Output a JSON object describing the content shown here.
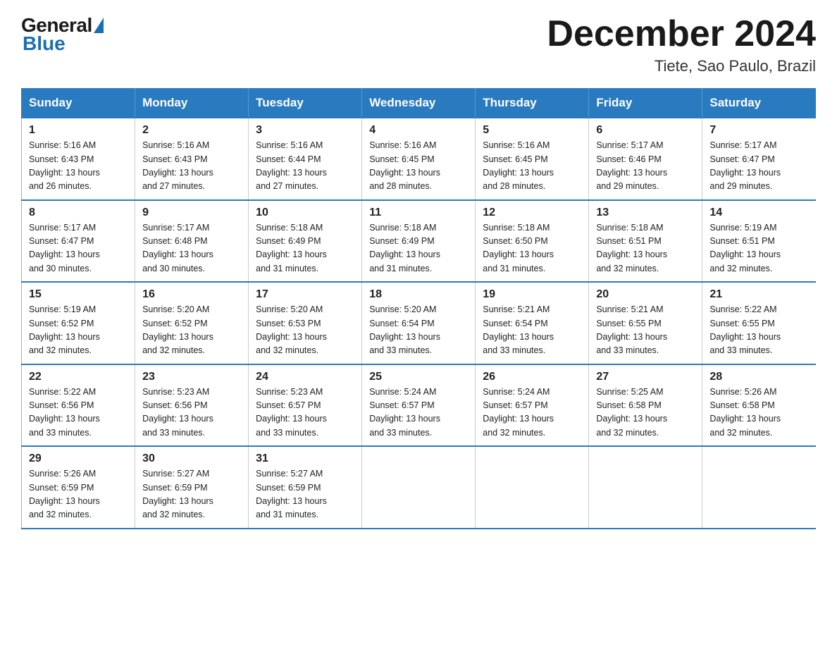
{
  "header": {
    "logo": {
      "general": "General",
      "blue": "Blue"
    },
    "title": "December 2024",
    "location": "Tiete, Sao Paulo, Brazil"
  },
  "days_of_week": [
    "Sunday",
    "Monday",
    "Tuesday",
    "Wednesday",
    "Thursday",
    "Friday",
    "Saturday"
  ],
  "weeks": [
    [
      {
        "num": "1",
        "sunrise": "5:16 AM",
        "sunset": "6:43 PM",
        "daylight": "13 hours and 26 minutes."
      },
      {
        "num": "2",
        "sunrise": "5:16 AM",
        "sunset": "6:43 PM",
        "daylight": "13 hours and 27 minutes."
      },
      {
        "num": "3",
        "sunrise": "5:16 AM",
        "sunset": "6:44 PM",
        "daylight": "13 hours and 27 minutes."
      },
      {
        "num": "4",
        "sunrise": "5:16 AM",
        "sunset": "6:45 PM",
        "daylight": "13 hours and 28 minutes."
      },
      {
        "num": "5",
        "sunrise": "5:16 AM",
        "sunset": "6:45 PM",
        "daylight": "13 hours and 28 minutes."
      },
      {
        "num": "6",
        "sunrise": "5:17 AM",
        "sunset": "6:46 PM",
        "daylight": "13 hours and 29 minutes."
      },
      {
        "num": "7",
        "sunrise": "5:17 AM",
        "sunset": "6:47 PM",
        "daylight": "13 hours and 29 minutes."
      }
    ],
    [
      {
        "num": "8",
        "sunrise": "5:17 AM",
        "sunset": "6:47 PM",
        "daylight": "13 hours and 30 minutes."
      },
      {
        "num": "9",
        "sunrise": "5:17 AM",
        "sunset": "6:48 PM",
        "daylight": "13 hours and 30 minutes."
      },
      {
        "num": "10",
        "sunrise": "5:18 AM",
        "sunset": "6:49 PM",
        "daylight": "13 hours and 31 minutes."
      },
      {
        "num": "11",
        "sunrise": "5:18 AM",
        "sunset": "6:49 PM",
        "daylight": "13 hours and 31 minutes."
      },
      {
        "num": "12",
        "sunrise": "5:18 AM",
        "sunset": "6:50 PM",
        "daylight": "13 hours and 31 minutes."
      },
      {
        "num": "13",
        "sunrise": "5:18 AM",
        "sunset": "6:51 PM",
        "daylight": "13 hours and 32 minutes."
      },
      {
        "num": "14",
        "sunrise": "5:19 AM",
        "sunset": "6:51 PM",
        "daylight": "13 hours and 32 minutes."
      }
    ],
    [
      {
        "num": "15",
        "sunrise": "5:19 AM",
        "sunset": "6:52 PM",
        "daylight": "13 hours and 32 minutes."
      },
      {
        "num": "16",
        "sunrise": "5:20 AM",
        "sunset": "6:52 PM",
        "daylight": "13 hours and 32 minutes."
      },
      {
        "num": "17",
        "sunrise": "5:20 AM",
        "sunset": "6:53 PM",
        "daylight": "13 hours and 32 minutes."
      },
      {
        "num": "18",
        "sunrise": "5:20 AM",
        "sunset": "6:54 PM",
        "daylight": "13 hours and 33 minutes."
      },
      {
        "num": "19",
        "sunrise": "5:21 AM",
        "sunset": "6:54 PM",
        "daylight": "13 hours and 33 minutes."
      },
      {
        "num": "20",
        "sunrise": "5:21 AM",
        "sunset": "6:55 PM",
        "daylight": "13 hours and 33 minutes."
      },
      {
        "num": "21",
        "sunrise": "5:22 AM",
        "sunset": "6:55 PM",
        "daylight": "13 hours and 33 minutes."
      }
    ],
    [
      {
        "num": "22",
        "sunrise": "5:22 AM",
        "sunset": "6:56 PM",
        "daylight": "13 hours and 33 minutes."
      },
      {
        "num": "23",
        "sunrise": "5:23 AM",
        "sunset": "6:56 PM",
        "daylight": "13 hours and 33 minutes."
      },
      {
        "num": "24",
        "sunrise": "5:23 AM",
        "sunset": "6:57 PM",
        "daylight": "13 hours and 33 minutes."
      },
      {
        "num": "25",
        "sunrise": "5:24 AM",
        "sunset": "6:57 PM",
        "daylight": "13 hours and 33 minutes."
      },
      {
        "num": "26",
        "sunrise": "5:24 AM",
        "sunset": "6:57 PM",
        "daylight": "13 hours and 32 minutes."
      },
      {
        "num": "27",
        "sunrise": "5:25 AM",
        "sunset": "6:58 PM",
        "daylight": "13 hours and 32 minutes."
      },
      {
        "num": "28",
        "sunrise": "5:26 AM",
        "sunset": "6:58 PM",
        "daylight": "13 hours and 32 minutes."
      }
    ],
    [
      {
        "num": "29",
        "sunrise": "5:26 AM",
        "sunset": "6:59 PM",
        "daylight": "13 hours and 32 minutes."
      },
      {
        "num": "30",
        "sunrise": "5:27 AM",
        "sunset": "6:59 PM",
        "daylight": "13 hours and 32 minutes."
      },
      {
        "num": "31",
        "sunrise": "5:27 AM",
        "sunset": "6:59 PM",
        "daylight": "13 hours and 31 minutes."
      },
      null,
      null,
      null,
      null
    ]
  ],
  "labels": {
    "sunrise": "Sunrise:",
    "sunset": "Sunset:",
    "daylight": "Daylight:"
  }
}
